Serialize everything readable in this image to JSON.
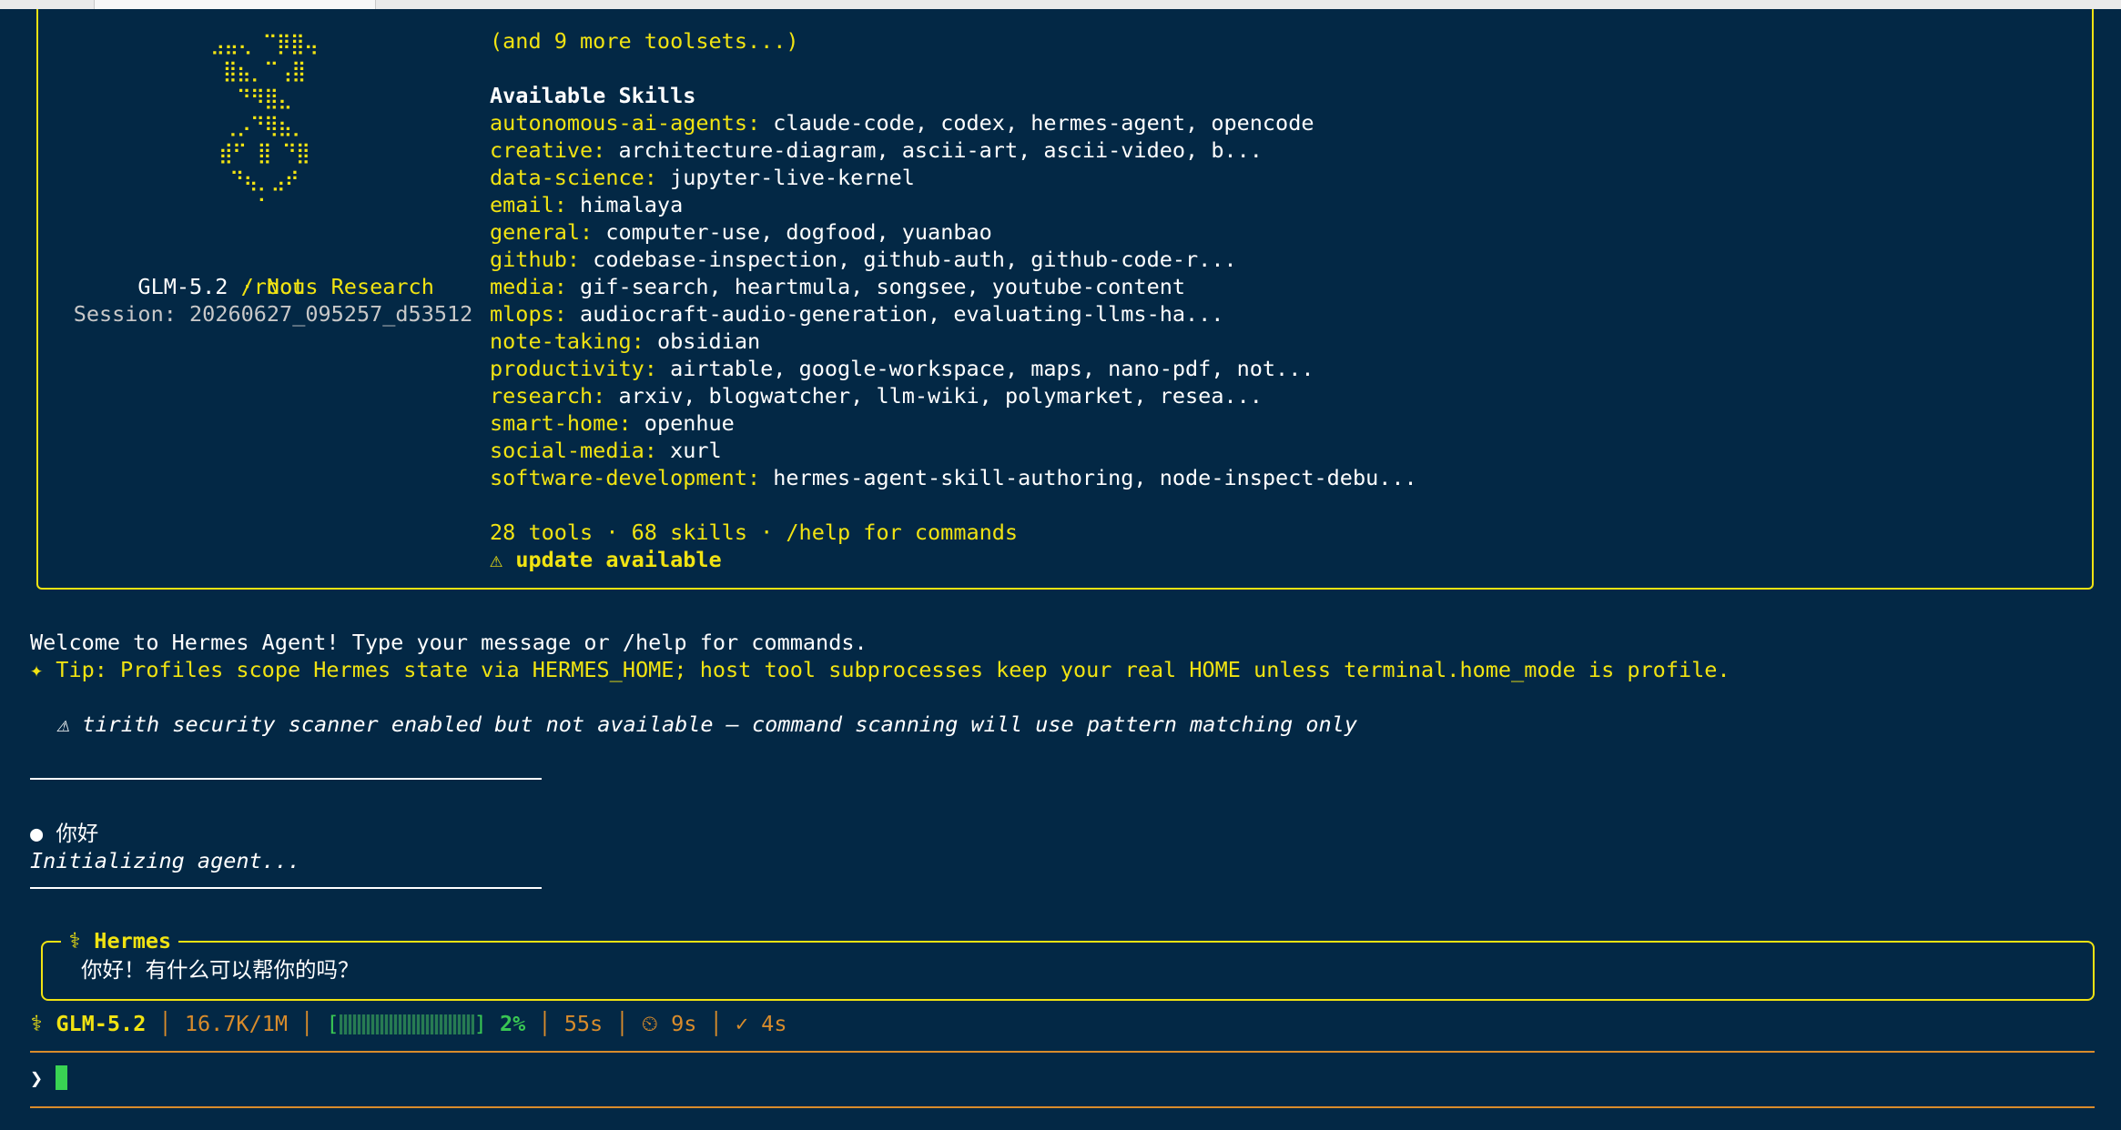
{
  "banner": {
    "logo_lines": [
      "⣠⣤⢄ ⠉⡿⣿⢤",
      "⣿⣦⡀⠉⢠⣿",
      "⠙⠻⣿⣄",
      "⢀⡠⠙⢿⣦⡀",
      "⣾⠋ ⣿ ⠙⣿",
      "⠙⢦⡀⣠⠞",
      "⠁"
    ],
    "model": "GLM-5.2",
    "provider_sep": " · ",
    "provider": "Nous Research",
    "cwd": "/root",
    "session": "Session: 20260627_095257_d53512",
    "more_toolsets": "(and 9 more toolsets...)",
    "skills_heading": "Available Skills",
    "skills": [
      {
        "category": "autonomous-ai-agents:",
        "items": "claude-code, codex, hermes-agent, opencode"
      },
      {
        "category": "creative:",
        "items": "architecture-diagram, ascii-art, ascii-video, b..."
      },
      {
        "category": "data-science:",
        "items": "jupyter-live-kernel"
      },
      {
        "category": "email:",
        "items": "himalaya"
      },
      {
        "category": "general:",
        "items": "computer-use, dogfood, yuanbao"
      },
      {
        "category": "github:",
        "items": "codebase-inspection, github-auth, github-code-r..."
      },
      {
        "category": "media:",
        "items": "gif-search, heartmula, songsee, youtube-content"
      },
      {
        "category": "mlops:",
        "items": "audiocraft-audio-generation, evaluating-llms-ha..."
      },
      {
        "category": "note-taking:",
        "items": "obsidian"
      },
      {
        "category": "productivity:",
        "items": "airtable, google-workspace, maps, nano-pdf, not..."
      },
      {
        "category": "research:",
        "items": "arxiv, blogwatcher, llm-wiki, polymarket, resea..."
      },
      {
        "category": "smart-home:",
        "items": "openhue"
      },
      {
        "category": "social-media:",
        "items": "xurl"
      },
      {
        "category": "software-development:",
        "items": "hermes-agent-skill-authoring, node-inspect-debu..."
      }
    ],
    "summary": "28 tools · 68 skills · /help for commands",
    "update_icon": "⚠",
    "update": "update available"
  },
  "welcome": "Welcome to Hermes Agent! Type your message or /help for commands.",
  "tip": "✦ Tip: Profiles scope Hermes state via HERMES_HOME; host tool subprocesses keep your real HOME unless terminal.home_mode is profile.",
  "warning": "⚠ tirith security scanner enabled but not available — command scanning will use pattern matching only",
  "user_message": {
    "bullet": "●",
    "text": "你好"
  },
  "initializing": "Initializing agent...",
  "hermes": {
    "title": "⚕ Hermes",
    "reply": "你好！有什么可以帮你的吗？"
  },
  "status": {
    "icon": "⚕",
    "model": "GLM-5.2",
    "context": "16.7K/1M",
    "bar_open": "[",
    "bar_close": "]",
    "progress": 2,
    "percent": "2%",
    "elapsed": "55s",
    "timer": "⏲ 9s",
    "done": "✓ 4s"
  },
  "prompt": {
    "symbol": "❯",
    "value": ""
  },
  "colors": {
    "background": "#032845",
    "accent": "#f1e312",
    "status": "#d98c2b",
    "cursor": "#39d353"
  }
}
